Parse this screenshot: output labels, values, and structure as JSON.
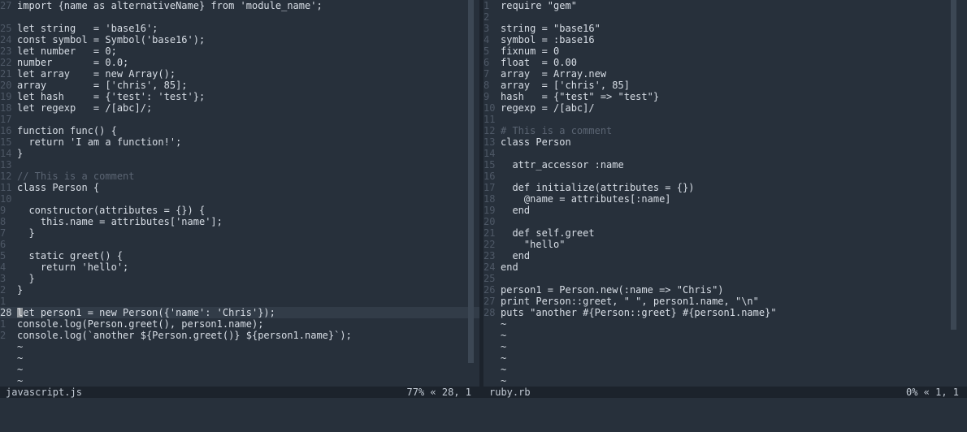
{
  "left_editor": {
    "filename": "javascript.js",
    "position": "77% « 28, 1",
    "lines": [
      {
        "n": "27",
        "t": "import {name as alternativeName} from 'module_name';"
      },
      {
        "n": "",
        "t": ""
      },
      {
        "n": "25",
        "t": "let string   = 'base16';"
      },
      {
        "n": "24",
        "t": "const symbol = Symbol('base16');"
      },
      {
        "n": "23",
        "t": "let number   = 0;"
      },
      {
        "n": "22",
        "t": "number       = 0.0;"
      },
      {
        "n": "21",
        "t": "let array    = new Array();"
      },
      {
        "n": "20",
        "t": "array        = ['chris', 85];"
      },
      {
        "n": "19",
        "t": "let hash     = {'test': 'test'};"
      },
      {
        "n": "18",
        "t": "let regexp   = /[abc]/;"
      },
      {
        "n": "17",
        "t": ""
      },
      {
        "n": "16",
        "t": "function func() {"
      },
      {
        "n": "15",
        "t": "  return 'I am a function!';"
      },
      {
        "n": "14",
        "t": "}"
      },
      {
        "n": "13",
        "t": ""
      },
      {
        "n": "12",
        "t": "// This is a comment"
      },
      {
        "n": "11",
        "t": "class Person {"
      },
      {
        "n": "10",
        "t": ""
      },
      {
        "n": "9",
        "t": "  constructor(attributes = {}) {"
      },
      {
        "n": "8",
        "t": "    this.name = attributes['name'];"
      },
      {
        "n": "7",
        "t": "  }"
      },
      {
        "n": "6",
        "t": ""
      },
      {
        "n": "5",
        "t": "  static greet() {"
      },
      {
        "n": "4",
        "t": "    return 'hello';"
      },
      {
        "n": "3",
        "t": "  }"
      },
      {
        "n": "2",
        "t": "}"
      },
      {
        "n": "1",
        "t": ""
      },
      {
        "n": "28",
        "t": "let person1 = new Person({'name': 'Chris'});"
      },
      {
        "n": "1",
        "t": "console.log(Person.greet(), person1.name);"
      },
      {
        "n": "2",
        "t": "console.log(`another ${Person.greet()} ${person1.name}`);"
      },
      {
        "n": "",
        "t": "~"
      },
      {
        "n": "",
        "t": "~"
      },
      {
        "n": "",
        "t": "~"
      },
      {
        "n": "",
        "t": "~"
      }
    ]
  },
  "right_editor": {
    "filename": "ruby.rb",
    "position": "0% « 1, 1",
    "lines": [
      {
        "n": "1",
        "t": "require \"gem\""
      },
      {
        "n": "2",
        "t": ""
      },
      {
        "n": "3",
        "t": "string = \"base16\""
      },
      {
        "n": "4",
        "t": "symbol = :base16"
      },
      {
        "n": "5",
        "t": "fixnum = 0"
      },
      {
        "n": "6",
        "t": "float  = 0.00"
      },
      {
        "n": "7",
        "t": "array  = Array.new"
      },
      {
        "n": "8",
        "t": "array  = ['chris', 85]"
      },
      {
        "n": "9",
        "t": "hash   = {\"test\" => \"test\"}"
      },
      {
        "n": "10",
        "t": "regexp = /[abc]/"
      },
      {
        "n": "11",
        "t": ""
      },
      {
        "n": "12",
        "t": "# This is a comment"
      },
      {
        "n": "13",
        "t": "class Person"
      },
      {
        "n": "14",
        "t": ""
      },
      {
        "n": "15",
        "t": "  attr_accessor :name"
      },
      {
        "n": "16",
        "t": ""
      },
      {
        "n": "17",
        "t": "  def initialize(attributes = {})"
      },
      {
        "n": "18",
        "t": "    @name = attributes[:name]"
      },
      {
        "n": "19",
        "t": "  end"
      },
      {
        "n": "20",
        "t": ""
      },
      {
        "n": "21",
        "t": "  def self.greet"
      },
      {
        "n": "22",
        "t": "    \"hello\""
      },
      {
        "n": "23",
        "t": "  end"
      },
      {
        "n": "24",
        "t": "end"
      },
      {
        "n": "25",
        "t": ""
      },
      {
        "n": "26",
        "t": "person1 = Person.new(:name => \"Chris\")"
      },
      {
        "n": "27",
        "t": "print Person::greet, \" \", person1.name, \"\\n\""
      },
      {
        "n": "28",
        "t": "puts \"another #{Person::greet} #{person1.name}\""
      },
      {
        "n": "",
        "t": "~"
      },
      {
        "n": "",
        "t": "~"
      },
      {
        "n": "",
        "t": "~"
      },
      {
        "n": "",
        "t": "~"
      },
      {
        "n": "",
        "t": "~"
      },
      {
        "n": "",
        "t": "~"
      }
    ]
  }
}
